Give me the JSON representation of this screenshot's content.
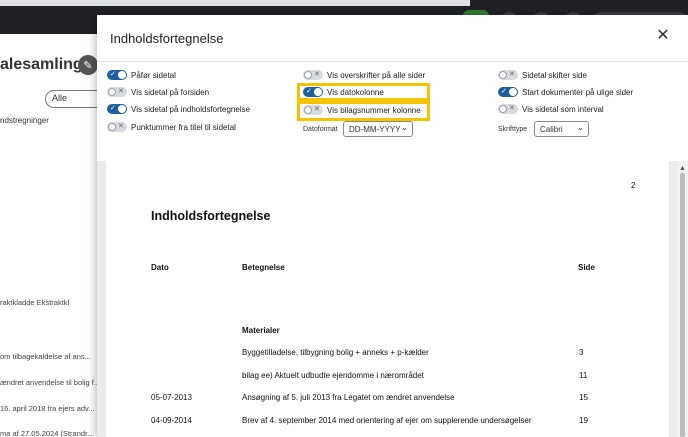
{
  "background": {
    "title": "alesamling",
    "select_value": "Alle",
    "column_header": "ndstregninger",
    "rows": [
      "raktkladde Ekstraktkl",
      "om tilbagekaldelse af ans...",
      "ændret anvendelse til bolig f...",
      "16. april 2018 fra ejers adv...",
      "ma af 27.05.2024 (Strandr..."
    ]
  },
  "dialog": {
    "title": "Indholdsfortegnelse",
    "close_icon": "close-icon",
    "options_col1": [
      {
        "label": "Påfør sidetal",
        "on": true
      },
      {
        "label": "Vis sidetal på forsiden",
        "on": false
      },
      {
        "label": "Vis sidetal på indholdsfortegnelse",
        "on": true
      },
      {
        "label": "Punktummer fra titel til sidetal",
        "on": false
      }
    ],
    "options_col2": [
      {
        "label": "Vis overskrifter på alle sider",
        "on": false
      },
      {
        "label": "Vis datokolonne",
        "on": true
      },
      {
        "label": "Vis bilagsnummer kolonne",
        "on": false
      }
    ],
    "options_col3": [
      {
        "label": "Sidetal skifter side",
        "on": false
      },
      {
        "label": "Start dokumenter på ulige sider",
        "on": true
      },
      {
        "label": "Vis sidetal som interval",
        "on": false
      }
    ],
    "date_format_label": "Datoformat",
    "date_format_value": "DD-MM-YYYY",
    "font_label": "Skrifttype",
    "font_value": "Calibri",
    "highlight_color": "#f2c500",
    "toggle_on_color": "#1f5fa0"
  },
  "preview": {
    "page_number": "2",
    "heading": "Indholdsfortegnelse",
    "col_date": "Dato",
    "col_title": "Betegnelse",
    "col_page": "Side",
    "section": "Materialer",
    "entries": [
      {
        "date": "",
        "title": "Byggetilladelse, tilbygning bolig + anneks + p-kælder",
        "page": "3"
      },
      {
        "date": "",
        "title": "bilag ee) Aktuelt udbudte ejendomme i nærområdet",
        "page": "11"
      },
      {
        "date": "05-07-2013",
        "title": "Ansøgning af 5. juli 2013 fra Legatet om ændret anvendelse",
        "page": "15"
      },
      {
        "date": "04-09-2014",
        "title": "Brev af 4. september 2014 med orientering af ejer om supplerende undersøgelser",
        "page": "19"
      }
    ]
  }
}
